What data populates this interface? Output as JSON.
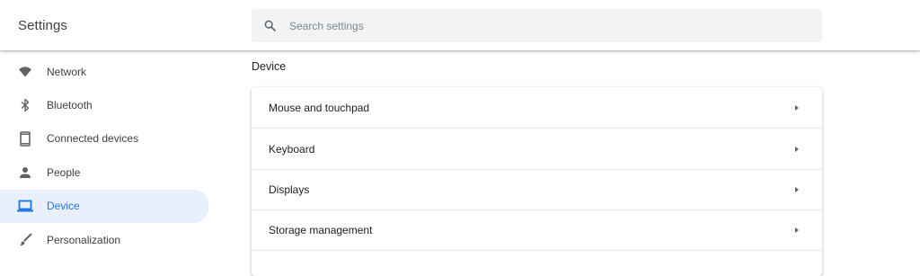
{
  "header": {
    "title": "Settings",
    "search": {
      "placeholder": "Search settings",
      "icon": "search-icon"
    }
  },
  "sidebar": {
    "items": [
      {
        "label": "Network",
        "icon": "wifi-icon"
      },
      {
        "label": "Bluetooth",
        "icon": "bluetooth-icon"
      },
      {
        "label": "Connected devices",
        "icon": "phone-icon"
      },
      {
        "label": "People",
        "icon": "person-icon"
      },
      {
        "label": "Device",
        "icon": "laptop-icon",
        "active": true
      },
      {
        "label": "Personalization",
        "icon": "brush-icon"
      }
    ]
  },
  "main": {
    "section_title": "Device",
    "rows": [
      {
        "label": "Mouse and touchpad"
      },
      {
        "label": "Keyboard"
      },
      {
        "label": "Displays"
      },
      {
        "label": "Storage management"
      }
    ]
  },
  "colors": {
    "accent": "#1a73e8",
    "active_bg": "#e8f0fe",
    "icon_gray": "#5f6368",
    "search_bg": "#f1f3f4"
  }
}
